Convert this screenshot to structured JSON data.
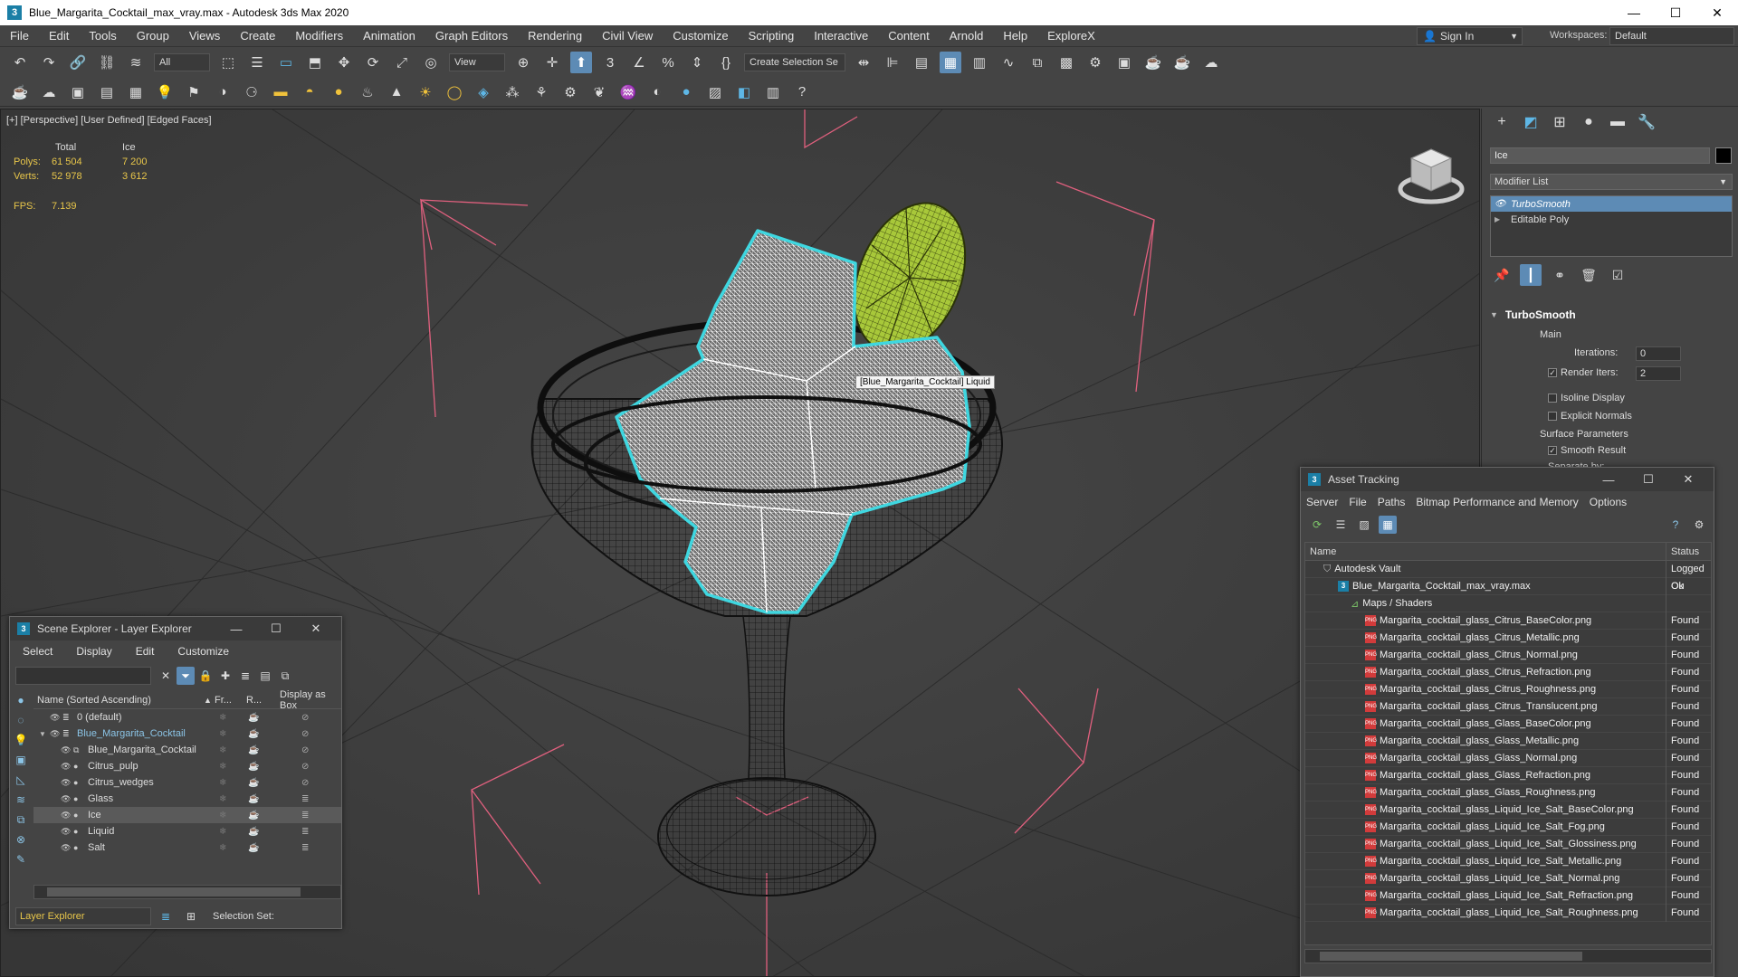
{
  "window": {
    "title": "Blue_Margarita_Cocktail_max_vray.max - Autodesk 3ds Max 2020",
    "controls": [
      "—",
      "☐",
      "✕"
    ]
  },
  "menu": [
    "File",
    "Edit",
    "Tools",
    "Group",
    "Views",
    "Create",
    "Modifiers",
    "Animation",
    "Graph Editors",
    "Rendering",
    "Civil View",
    "Customize",
    "Scripting",
    "Interactive",
    "Content",
    "Arnold",
    "Help",
    "ExploreX"
  ],
  "signin": "Sign In",
  "workspaces": {
    "label": "Workspaces:",
    "value": "Default"
  },
  "toolbar": {
    "filter": "All",
    "ref_coord": "View",
    "selection_set": "Create Selection Se"
  },
  "viewport": {
    "label": "[+] [Perspective] [User Defined] [Edged Faces]",
    "stats": {
      "headers": [
        "",
        "Total",
        "Ice"
      ],
      "rows": [
        {
          "label": "Polys:",
          "total": "61 504",
          "sel": "7 200"
        },
        {
          "label": "Verts:",
          "total": "52 978",
          "sel": "3 612"
        }
      ],
      "fps_label": "FPS:",
      "fps_value": "7.139"
    },
    "tooltip": "[Blue_Margarita_Cocktail] Liquid"
  },
  "command_panel": {
    "object_name": "Ice",
    "modifier_list": "Modifier List",
    "stack": [
      {
        "label": "TurboSmooth",
        "selected": true
      },
      {
        "label": "Editable Poly",
        "selected": false
      }
    ],
    "turbosmooth": {
      "title": "TurboSmooth",
      "main_label": "Main",
      "iterations_label": "Iterations:",
      "iterations": "0",
      "render_iters_label": "Render Iters:",
      "render_iters": "2",
      "isoline": "Isoline Display",
      "explicit_normals": "Explicit Normals",
      "surface_params": "Surface Parameters",
      "smooth_result": "Smooth Result",
      "separate_by": "Separate by:"
    }
  },
  "scene_explorer": {
    "title": "Scene Explorer - Layer Explorer",
    "menu": [
      "Select",
      "Display",
      "Edit",
      "Customize"
    ],
    "columns": [
      "Name (Sorted Ascending)",
      "Fr...",
      "R...",
      "Display as Box"
    ],
    "rows": [
      {
        "name": "0 (default)",
        "indent": 1,
        "selected": false
      },
      {
        "name": "Blue_Margarita_Cocktail",
        "indent": 1,
        "selected": false
      },
      {
        "name": "Blue_Margarita_Cocktail",
        "indent": 2,
        "selected": false
      },
      {
        "name": "Citrus_pulp",
        "indent": 2,
        "selected": false
      },
      {
        "name": "Citrus_wedges",
        "indent": 2,
        "selected": false
      },
      {
        "name": "Glass",
        "indent": 2,
        "selected": false
      },
      {
        "name": "Ice",
        "indent": 2,
        "selected": true
      },
      {
        "name": "Liquid",
        "indent": 2,
        "selected": false
      },
      {
        "name": "Salt",
        "indent": 2,
        "selected": false
      }
    ],
    "footer_select": "Layer Explorer",
    "selection_set": "Selection Set:"
  },
  "asset_tracking": {
    "title": "Asset Tracking",
    "menu": [
      "Server",
      "File",
      "Paths",
      "Bitmap Performance and Memory",
      "Options"
    ],
    "columns": [
      "Name",
      "Status"
    ],
    "rows": [
      {
        "name": "Autodesk Vault",
        "status": "Logged Ou",
        "level": 0,
        "kind": "vault"
      },
      {
        "name": "Blue_Margarita_Cocktail_max_vray.max",
        "status": "Ok",
        "level": 1,
        "kind": "max"
      },
      {
        "name": "Maps / Shaders",
        "status": "",
        "level": 2,
        "kind": "maps"
      },
      {
        "name": "Margarita_cocktail_glass_Citrus_BaseColor.png",
        "status": "Found",
        "level": 3,
        "kind": "png"
      },
      {
        "name": "Margarita_cocktail_glass_Citrus_Metallic.png",
        "status": "Found",
        "level": 3,
        "kind": "png"
      },
      {
        "name": "Margarita_cocktail_glass_Citrus_Normal.png",
        "status": "Found",
        "level": 3,
        "kind": "png"
      },
      {
        "name": "Margarita_cocktail_glass_Citrus_Refraction.png",
        "status": "Found",
        "level": 3,
        "kind": "png"
      },
      {
        "name": "Margarita_cocktail_glass_Citrus_Roughness.png",
        "status": "Found",
        "level": 3,
        "kind": "png"
      },
      {
        "name": "Margarita_cocktail_glass_Citrus_Translucent.png",
        "status": "Found",
        "level": 3,
        "kind": "png"
      },
      {
        "name": "Margarita_cocktail_glass_Glass_BaseColor.png",
        "status": "Found",
        "level": 3,
        "kind": "png"
      },
      {
        "name": "Margarita_cocktail_glass_Glass_Metallic.png",
        "status": "Found",
        "level": 3,
        "kind": "png"
      },
      {
        "name": "Margarita_cocktail_glass_Glass_Normal.png",
        "status": "Found",
        "level": 3,
        "kind": "png"
      },
      {
        "name": "Margarita_cocktail_glass_Glass_Refraction.png",
        "status": "Found",
        "level": 3,
        "kind": "png"
      },
      {
        "name": "Margarita_cocktail_glass_Glass_Roughness.png",
        "status": "Found",
        "level": 3,
        "kind": "png"
      },
      {
        "name": "Margarita_cocktail_glass_Liquid_Ice_Salt_BaseColor.png",
        "status": "Found",
        "level": 3,
        "kind": "png"
      },
      {
        "name": "Margarita_cocktail_glass_Liquid_Ice_Salt_Fog.png",
        "status": "Found",
        "level": 3,
        "kind": "png"
      },
      {
        "name": "Margarita_cocktail_glass_Liquid_Ice_Salt_Glossiness.png",
        "status": "Found",
        "level": 3,
        "kind": "png"
      },
      {
        "name": "Margarita_cocktail_glass_Liquid_Ice_Salt_Metallic.png",
        "status": "Found",
        "level": 3,
        "kind": "png"
      },
      {
        "name": "Margarita_cocktail_glass_Liquid_Ice_Salt_Normal.png",
        "status": "Found",
        "level": 3,
        "kind": "png"
      },
      {
        "name": "Margarita_cocktail_glass_Liquid_Ice_Salt_Refraction.png",
        "status": "Found",
        "level": 3,
        "kind": "png"
      },
      {
        "name": "Margarita_cocktail_glass_Liquid_Ice_Salt_Roughness.png",
        "status": "Found",
        "level": 3,
        "kind": "png"
      }
    ]
  },
  "colors": {
    "selection_outline": "#3fd7e0",
    "stats_text": "#e8c64a",
    "selected_highlight": "#5d8bb5",
    "gizmo_lines": "#e0607e",
    "lime": "#a8c83a"
  }
}
